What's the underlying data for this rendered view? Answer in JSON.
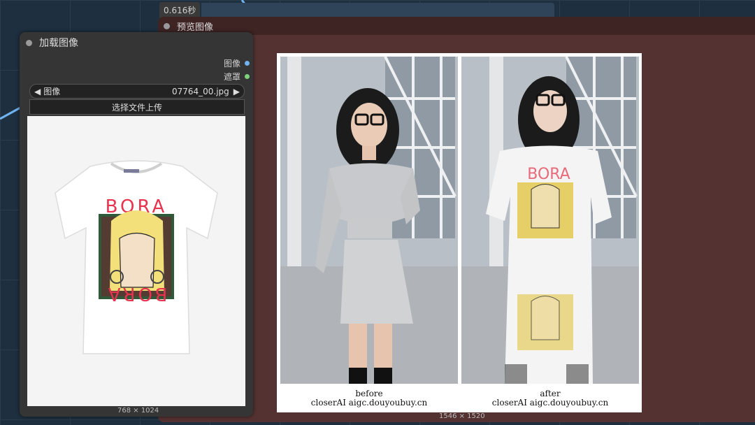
{
  "canvas": {
    "background": "#1e2f3f",
    "link_color": "#7fb8e8"
  },
  "timing_badge": "0.616秒",
  "preview_node": {
    "title": "预览图像",
    "image_size": "1546 × 1520",
    "image": {
      "left_caption": "before",
      "right_caption": "after",
      "watermark_left": "closerAI   aigc.douyoubuy.cn",
      "watermark_right": "closerAI   aigc.douyoubuy.cn"
    }
  },
  "load_node": {
    "title": "加载图像",
    "outputs": [
      {
        "label": "图像",
        "color": "#6fb3f0"
      },
      {
        "label": "遮罩",
        "color": "#7ed27e"
      }
    ],
    "image_widget": {
      "label": "图像",
      "value": "07764_00.jpg"
    },
    "upload_button": "选择文件上传",
    "image_size": "768 × 1024",
    "tshirt_print_text": "BORA"
  }
}
